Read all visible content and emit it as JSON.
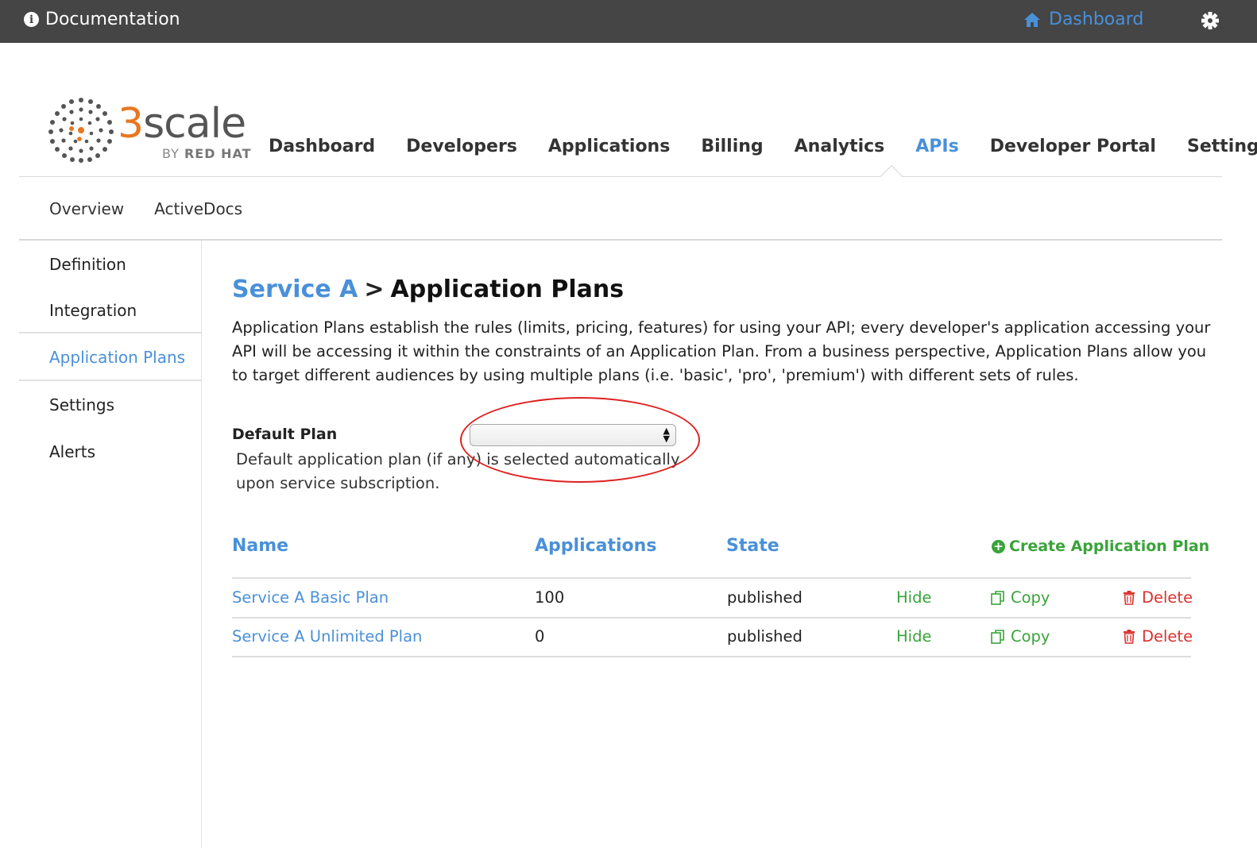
{
  "topbar": {
    "documentation_label": "Documentation",
    "dashboard_label": "Dashboard"
  },
  "logo": {
    "three": "3",
    "scale": "scale",
    "by": "BY ",
    "redhat": "RED HAT"
  },
  "main_nav": {
    "items": [
      "Dashboard",
      "Developers",
      "Applications",
      "Billing",
      "Analytics",
      "APIs",
      "Developer Portal",
      "Settings"
    ],
    "active": "APIs"
  },
  "sub_nav": {
    "items": [
      "Overview",
      "ActiveDocs"
    ]
  },
  "sidebar": {
    "items": [
      "Definition",
      "Integration",
      "Application Plans",
      "Settings",
      "Alerts"
    ],
    "active": "Application Plans"
  },
  "page": {
    "breadcrumb": "Service A",
    "separator": ">",
    "title": "Application Plans",
    "description": "Application Plans establish the rules (limits, pricing, features) for using your API; every developer's application accessing your API will be accessing it within the constraints of an Application Plan. From a business perspective, Application Plans allow you to target different audiences by using multiple plans (i.e. 'basic', 'pro', 'premium') with different sets of rules."
  },
  "default_plan": {
    "label": "Default Plan",
    "value": "",
    "hint": "Default application plan (if any) is selected automatically upon service subscription."
  },
  "table": {
    "headers": {
      "name": "Name",
      "applications": "Applications",
      "state": "State"
    },
    "create_label": "Create Application Plan",
    "rows": [
      {
        "name": "Service A Basic Plan",
        "applications": "100",
        "state": "published",
        "hide": "Hide",
        "copy": "Copy",
        "delete": "Delete"
      },
      {
        "name": "Service A Unlimited Plan",
        "applications": "0",
        "state": "published",
        "hide": "Hide",
        "copy": "Copy",
        "delete": "Delete"
      }
    ]
  },
  "colors": {
    "accent": "#4a90d9",
    "brand_orange": "#e87722",
    "topbar": "#454545",
    "success": "#3aa33a",
    "danger": "#d9322f",
    "annotation": "#e02020"
  }
}
